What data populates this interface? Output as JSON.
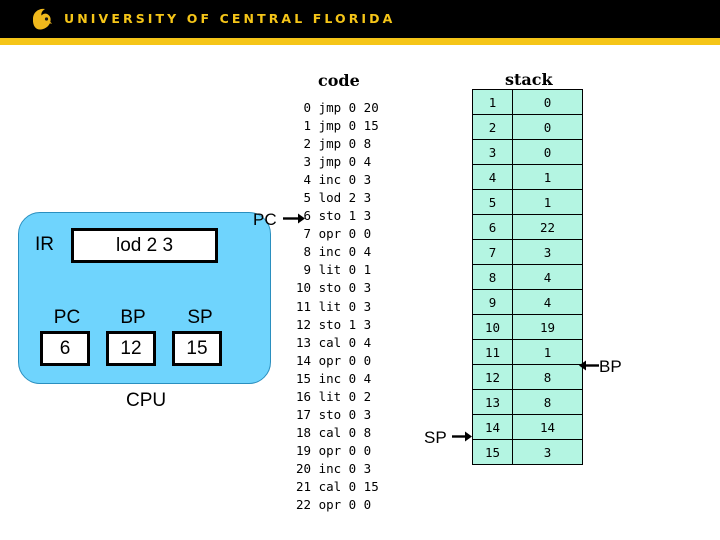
{
  "header": {
    "logo_icon": "pegasus-logo-icon",
    "title": "UNIVERSITY OF CENTRAL FLORIDA",
    "band_color": "#000000",
    "stripe_color": "#f5c518",
    "text_color": "#f5c518"
  },
  "code_panel": {
    "title": "code",
    "rows": [
      {
        "addr": "0",
        "op": "jmp",
        "l": "0",
        "m": "20"
      },
      {
        "addr": "1",
        "op": "jmp",
        "l": "0",
        "m": "15"
      },
      {
        "addr": "2",
        "op": "jmp",
        "l": "0",
        "m": "8"
      },
      {
        "addr": "3",
        "op": "jmp",
        "l": "0",
        "m": "4"
      },
      {
        "addr": "4",
        "op": "inc",
        "l": "0",
        "m": "3"
      },
      {
        "addr": "5",
        "op": "lod",
        "l": "2",
        "m": "3"
      },
      {
        "addr": "6",
        "op": "sto",
        "l": "1",
        "m": "3"
      },
      {
        "addr": "7",
        "op": "opr",
        "l": "0",
        "m": "0"
      },
      {
        "addr": "8",
        "op": "inc",
        "l": "0",
        "m": "4"
      },
      {
        "addr": "9",
        "op": "lit",
        "l": "0",
        "m": "1"
      },
      {
        "addr": "10",
        "op": "sto",
        "l": "0",
        "m": "3"
      },
      {
        "addr": "11",
        "op": "lit",
        "l": "0",
        "m": "3"
      },
      {
        "addr": "12",
        "op": "sto",
        "l": "1",
        "m": "3"
      },
      {
        "addr": "13",
        "op": "cal",
        "l": "0",
        "m": "4"
      },
      {
        "addr": "14",
        "op": "opr",
        "l": "0",
        "m": "0"
      },
      {
        "addr": "15",
        "op": "inc",
        "l": "0",
        "m": "4"
      },
      {
        "addr": "16",
        "op": "lit",
        "l": "0",
        "m": "2"
      },
      {
        "addr": "17",
        "op": "sto",
        "l": "0",
        "m": "3"
      },
      {
        "addr": "18",
        "op": "cal",
        "l": "0",
        "m": "8"
      },
      {
        "addr": "19",
        "op": "opr",
        "l": "0",
        "m": "0"
      },
      {
        "addr": "20",
        "op": "inc",
        "l": "0",
        "m": "3"
      },
      {
        "addr": "21",
        "op": "cal",
        "l": "0",
        "m": "15"
      },
      {
        "addr": "22",
        "op": "opr",
        "l": "0",
        "m": "0"
      }
    ]
  },
  "stack_panel": {
    "title": "stack",
    "cell_color": "#b4f5e2",
    "rows": [
      {
        "index": "1",
        "value": "0"
      },
      {
        "index": "2",
        "value": "0"
      },
      {
        "index": "3",
        "value": "0"
      },
      {
        "index": "4",
        "value": "1"
      },
      {
        "index": "5",
        "value": "1"
      },
      {
        "index": "6",
        "value": "22"
      },
      {
        "index": "7",
        "value": "3"
      },
      {
        "index": "8",
        "value": "4"
      },
      {
        "index": "9",
        "value": "4"
      },
      {
        "index": "10",
        "value": "19"
      },
      {
        "index": "11",
        "value": "1"
      },
      {
        "index": "12",
        "value": "8"
      },
      {
        "index": "13",
        "value": "8"
      },
      {
        "index": "14",
        "value": "14"
      },
      {
        "index": "15",
        "value": "3"
      }
    ]
  },
  "cpu": {
    "caption": "CPU",
    "box_color": "#6fd4fd",
    "ir": {
      "label": "IR",
      "value": "lod 2 3"
    },
    "registers": [
      {
        "label": "PC",
        "value": "6"
      },
      {
        "label": "BP",
        "value": "12"
      },
      {
        "label": "SP",
        "value": "15"
      }
    ]
  },
  "pointers": [
    {
      "name": "PC",
      "label": "PC",
      "target": "code row 6",
      "direction": "right"
    },
    {
      "name": "SP",
      "label": "SP",
      "target": "stack row 15",
      "direction": "right"
    },
    {
      "name": "BP",
      "label": "BP",
      "target": "stack row 12",
      "direction": "left"
    }
  ]
}
